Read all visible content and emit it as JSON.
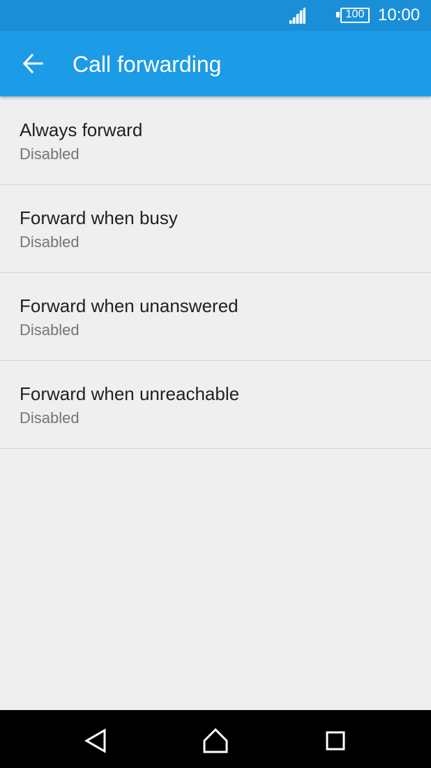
{
  "status_bar": {
    "battery_level": "100",
    "time": "10:00",
    "signal_icon": "signal-icon",
    "battery_icon": "battery-icon"
  },
  "app_bar": {
    "title": "Call forwarding",
    "back_icon": "arrow-back-icon"
  },
  "colors": {
    "status_bar": "#1a8fd8",
    "app_bar": "#1c9be6",
    "background": "#efefef",
    "nav_bar": "#000000"
  },
  "items": [
    {
      "title": "Always forward",
      "subtitle": "Disabled"
    },
    {
      "title": "Forward when busy",
      "subtitle": "Disabled"
    },
    {
      "title": "Forward when unanswered",
      "subtitle": "Disabled"
    },
    {
      "title": "Forward when unreachable",
      "subtitle": "Disabled"
    }
  ],
  "nav_bar": {
    "back_icon": "nav-back-icon",
    "home_icon": "nav-home-icon",
    "recents_icon": "nav-recents-icon"
  }
}
